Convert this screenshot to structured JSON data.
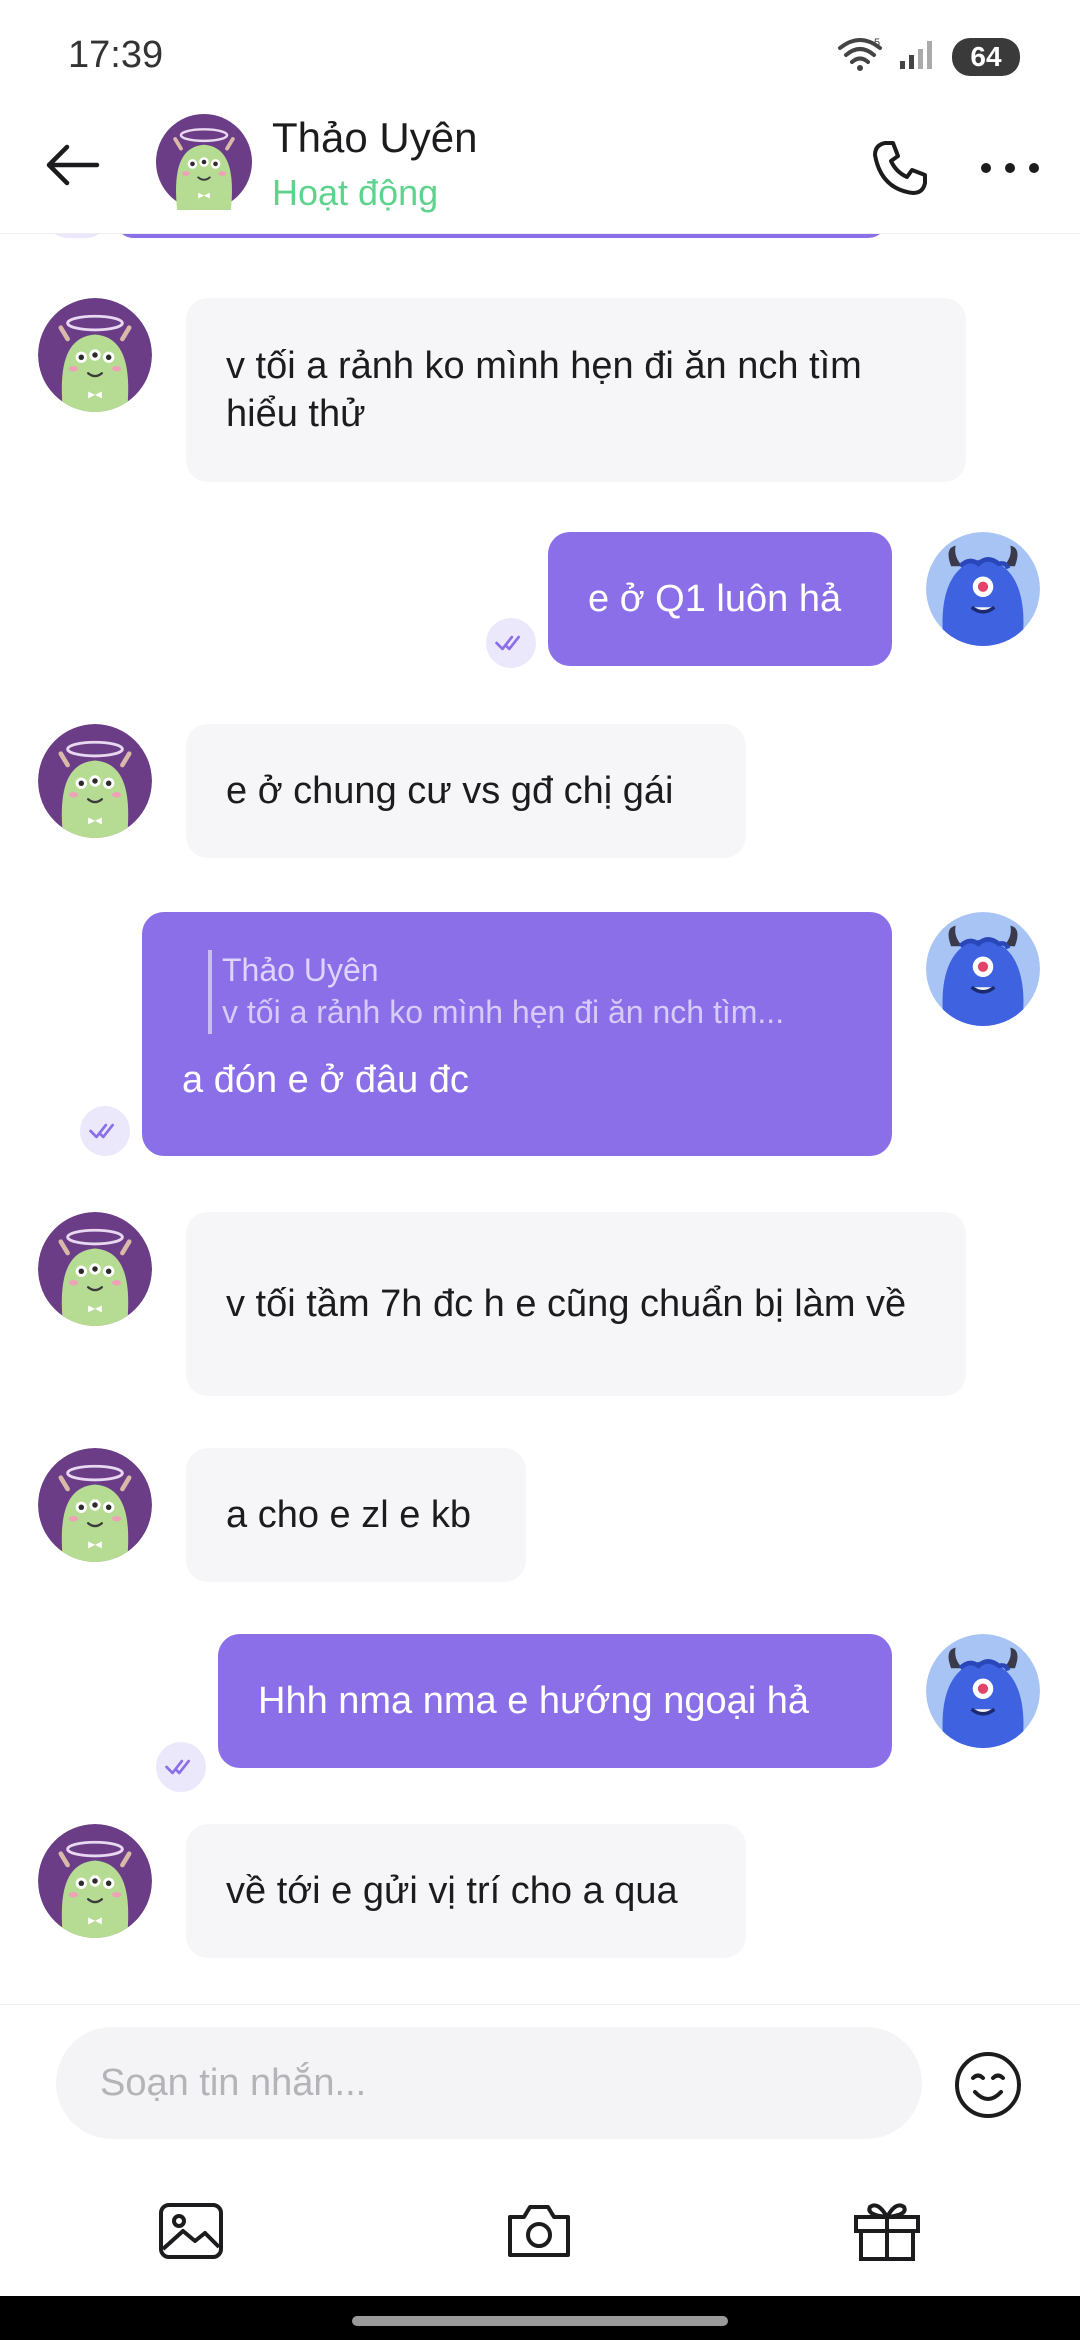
{
  "status_bar": {
    "time": "17:39",
    "battery": "64",
    "icons": [
      "wifi-icon",
      "signal-icon",
      "battery-icon"
    ]
  },
  "header": {
    "contact_name": "Thảo Uyên",
    "presence": "Hoạt động",
    "icons": [
      "back-arrow-icon",
      "phone-icon",
      "more-icon"
    ]
  },
  "colors": {
    "accent": "#8b6fe8",
    "incoming_bubble": "#f6f6f8",
    "presence_green": "#5fd38d"
  },
  "messages": [
    {
      "direction": "in",
      "text": "v tối a rảnh ko mình hẹn đi ăn nch tìm hiểu thử"
    },
    {
      "direction": "out",
      "text": "e ở Q1 luôn hả",
      "status": "seen"
    },
    {
      "direction": "in",
      "text": "e ở chung cư vs gđ chị gái"
    },
    {
      "direction": "out",
      "reply_to": {
        "name": "Thảo Uyên",
        "text": "v tối a rảnh ko mình hẹn đi ăn nch tìm..."
      },
      "text": "a đón e ở đâu đc",
      "status": "seen"
    },
    {
      "direction": "in",
      "text": "v tối tầm 7h đc h e cũng chuẩn bị làm về"
    },
    {
      "direction": "in",
      "text": "a cho e zl e kb"
    },
    {
      "direction": "out",
      "text": "Hhh nma nma e hướng ngoại hả",
      "status": "seen"
    },
    {
      "direction": "in",
      "text": "về tới e gửi vị trí cho a qua"
    }
  ],
  "composer": {
    "placeholder": "Soạn tin nhắn...",
    "value": ""
  },
  "toolbar": {
    "icons": [
      "image-icon",
      "camera-icon",
      "gift-icon"
    ]
  }
}
